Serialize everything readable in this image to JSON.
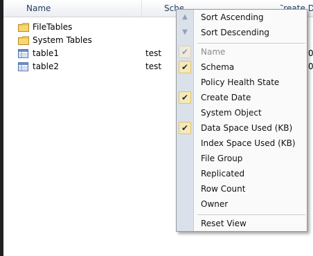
{
  "header": {
    "col_name": "Name",
    "col_schema": "Schema",
    "col_right": "Create Date"
  },
  "rows": [
    {
      "label": "FileTables",
      "icon": "folder-icon",
      "schema": "",
      "right": ""
    },
    {
      "label": "System Tables",
      "icon": "folder-icon",
      "schema": "",
      "right": ""
    },
    {
      "label": "table1",
      "icon": "table-icon",
      "schema": "test",
      "right": "0"
    },
    {
      "label": "table2",
      "icon": "table-icon",
      "schema": "test",
      "right": "0"
    }
  ],
  "menu": {
    "items": [
      {
        "label": "Sort Ascending",
        "icon": "sort-ascending-icon",
        "checked": false,
        "disabled": false
      },
      {
        "label": "Sort Descending",
        "icon": "sort-descending-icon",
        "checked": false,
        "disabled": false
      },
      {
        "label": "Name",
        "icon": "check-icon",
        "checked": true,
        "disabled": true
      },
      {
        "label": "Schema",
        "icon": "check-icon",
        "checked": true,
        "disabled": false
      },
      {
        "label": "Policy Health State",
        "icon": "",
        "checked": false,
        "disabled": false
      },
      {
        "label": "Create Date",
        "icon": "check-icon",
        "checked": true,
        "disabled": false
      },
      {
        "label": "System Object",
        "icon": "",
        "checked": false,
        "disabled": false
      },
      {
        "label": "Data Space Used (KB)",
        "icon": "check-icon",
        "checked": true,
        "disabled": false
      },
      {
        "label": "Index Space Used (KB)",
        "icon": "",
        "checked": false,
        "disabled": false
      },
      {
        "label": "File Group",
        "icon": "",
        "checked": false,
        "disabled": false
      },
      {
        "label": "Replicated",
        "icon": "",
        "checked": false,
        "disabled": false
      },
      {
        "label": "Row Count",
        "icon": "",
        "checked": false,
        "disabled": false
      },
      {
        "label": "Owner",
        "icon": "",
        "checked": false,
        "disabled": false
      },
      {
        "label": "Reset View",
        "icon": "",
        "checked": false,
        "disabled": false
      }
    ]
  },
  "colors": {
    "header_text": "#1e395b",
    "menu_gutter": "#dbe1ea",
    "check_highlight": "#f6e9b9",
    "check_border": "#e3c16b"
  }
}
